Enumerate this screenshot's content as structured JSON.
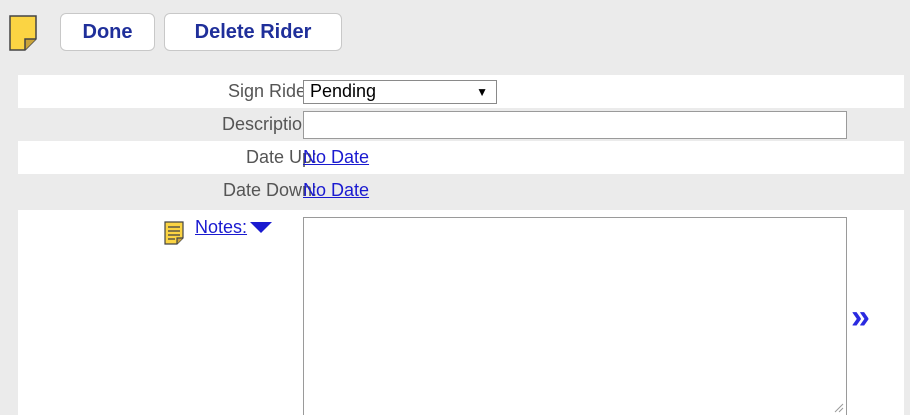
{
  "toolbar": {
    "done_label": "Done",
    "delete_label": "Delete Rider"
  },
  "form": {
    "sign_rider": {
      "label": "Sign Rider:",
      "value": "Pending"
    },
    "description": {
      "label": "Description:",
      "value": ""
    },
    "date_up": {
      "label": "Date Up:",
      "value": "No Date"
    },
    "date_down": {
      "label": "Date Down:",
      "value": "No Date"
    },
    "notes": {
      "label": "Notes:",
      "value": "",
      "expand_glyph": "»"
    }
  },
  "colors": {
    "accent": "#1f2f9a",
    "link": "#1a1ad0",
    "sticky_note": "#fbd443"
  }
}
